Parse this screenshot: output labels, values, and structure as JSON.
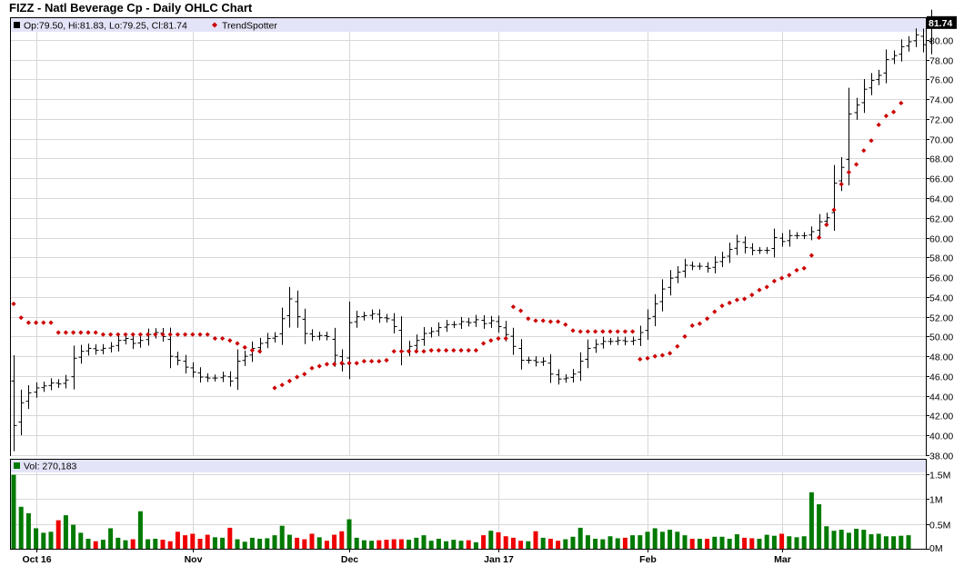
{
  "title": "FIZZ - Natl Beverage Cp - Daily OHLC Chart",
  "price_legend": {
    "ohlc_text": "Op:79.50, Hi:81.83, Lo:79.25, Cl:81.74",
    "trendspotter_label": "TrendSpotter"
  },
  "volume_legend": {
    "text": "Vol: 270,183"
  },
  "last_price_label": "81.74",
  "colors": {
    "bar": "#000000",
    "trendspotter": "#cc0000",
    "vol_up": "#007a00",
    "vol_down": "#ee0000",
    "legend_bg": "#e4e4f8",
    "grid": "#d8d8d8"
  },
  "chart_data": [
    {
      "type": "ohlc",
      "ylim": [
        38,
        82
      ],
      "yticks": [
        "38.00",
        "40.00",
        "42.00",
        "44.00",
        "46.00",
        "48.00",
        "50.00",
        "52.00",
        "54.00",
        "56.00",
        "58.00",
        "60.00",
        "62.00",
        "64.00",
        "66.00",
        "68.00",
        "70.00",
        "72.00",
        "74.00",
        "76.00",
        "78.00",
        "80.00"
      ],
      "xticks": [
        {
          "label": "Oct 16",
          "index": 3
        },
        {
          "label": "Nov",
          "index": 24
        },
        {
          "label": "Dec",
          "index": 45
        },
        {
          "label": "Jan 17",
          "index": 65
        },
        {
          "label": "Feb",
          "index": 85
        },
        {
          "label": "Mar",
          "index": 103
        }
      ],
      "series": [
        {
          "name": "OHLC",
          "close": [
            41.0,
            43.3,
            44.3,
            44.8,
            45.0,
            45.3,
            45.2,
            45.6,
            47.8,
            48.5,
            48.8,
            48.6,
            48.8,
            49.0,
            49.6,
            49.8,
            49.3,
            49.6,
            50.2,
            50.4,
            50.0,
            48.0,
            47.6,
            46.9,
            46.4,
            45.9,
            45.8,
            45.8,
            46.0,
            45.5,
            47.5,
            48.0,
            48.8,
            49.3,
            49.8,
            50.0,
            51.8,
            53.8,
            52.0,
            50.3,
            50.0,
            50.1,
            50.0,
            48.1,
            47.2,
            51.4,
            52.0,
            52.1,
            52.3,
            51.9,
            51.8,
            51.0,
            48.5,
            49.0,
            49.6,
            50.3,
            50.5,
            50.9,
            51.2,
            51.2,
            51.5,
            51.4,
            51.7,
            51.3,
            51.6,
            51.0,
            50.2,
            49.0,
            47.6,
            47.6,
            47.4,
            47.5,
            46.2,
            45.7,
            45.8,
            46.2,
            47.5,
            48.8,
            49.2,
            49.5,
            49.5,
            49.6,
            49.5,
            49.6,
            50.4,
            51.8,
            53.3,
            54.8,
            55.9,
            56.5,
            57.2,
            57.1,
            57.1,
            56.9,
            57.5,
            58.0,
            58.8,
            59.6,
            59.0,
            58.7,
            58.7,
            58.7,
            60.0,
            59.6,
            60.2,
            60.2,
            60.2,
            60.6,
            61.6,
            62.0,
            65.5,
            67.1,
            72.5,
            73.4,
            75.0,
            75.9,
            76.4,
            78.0,
            78.4,
            79.3,
            79.8,
            80.5,
            79.5,
            81.74
          ]
        },
        {
          "name": "TrendSpotter",
          "values": [
            53.3,
            51.9,
            51.4,
            51.4,
            51.4,
            51.4,
            50.4,
            50.4,
            50.4,
            50.4,
            50.4,
            50.4,
            50.2,
            50.2,
            50.2,
            50.2,
            50.2,
            50.2,
            50.2,
            50.2,
            50.2,
            50.2,
            50.2,
            50.2,
            50.2,
            50.2,
            50.2,
            49.8,
            49.8,
            49.6,
            49.3,
            48.9,
            48.6,
            48.5,
            null,
            44.8,
            45.1,
            45.5,
            45.9,
            46.2,
            46.8,
            47.0,
            47.2,
            47.2,
            47.3,
            47.3,
            47.3,
            47.5,
            47.5,
            47.5,
            47.6,
            48.5,
            48.5,
            48.5,
            48.5,
            48.5,
            48.6,
            48.6,
            48.6,
            48.6,
            48.6,
            48.6,
            48.6,
            49.3,
            49.6,
            49.8,
            49.8,
            53.0,
            52.6,
            51.8,
            51.6,
            51.6,
            51.5,
            51.5,
            51.2,
            50.6,
            50.5,
            50.5,
            50.5,
            50.5,
            50.5,
            50.5,
            50.5,
            50.5,
            47.7,
            47.8,
            48.0,
            48.1,
            48.3,
            49.0,
            50.0,
            51.1,
            51.3,
            51.8,
            52.5,
            53.1,
            53.4,
            53.7,
            53.8,
            54.2,
            54.7,
            55.0,
            55.6,
            55.9,
            56.2,
            56.7,
            56.9,
            58.2,
            60.0,
            61.3,
            62.8,
            65.4,
            66.6,
            67.4,
            68.8,
            69.8,
            71.4,
            72.3,
            72.7,
            73.6
          ]
        },
        {
          "name": "Vol",
          "values": [
            1.48,
            0.84,
            0.71,
            0.41,
            0.32,
            0.34,
            0.57,
            0.67,
            0.48,
            0.32,
            0.2,
            0.15,
            0.18,
            0.41,
            0.22,
            0.17,
            0.19,
            0.75,
            0.19,
            0.2,
            0.18,
            0.15,
            0.34,
            0.27,
            0.3,
            0.2,
            0.28,
            0.23,
            0.22,
            0.42,
            0.19,
            0.14,
            0.22,
            0.2,
            0.21,
            0.27,
            0.46,
            0.28,
            0.22,
            0.19,
            0.3,
            0.23,
            0.16,
            0.28,
            0.35,
            0.59,
            0.22,
            0.17,
            0.16,
            0.17,
            0.18,
            0.19,
            0.19,
            0.18,
            0.22,
            0.27,
            0.16,
            0.2,
            0.15,
            0.18,
            0.16,
            0.17,
            0.13,
            0.27,
            0.36,
            0.33,
            0.25,
            0.22,
            0.16,
            0.15,
            0.35,
            0.22,
            0.2,
            0.16,
            0.19,
            0.24,
            0.42,
            0.27,
            0.2,
            0.19,
            0.25,
            0.21,
            0.22,
            0.27,
            0.27,
            0.34,
            0.41,
            0.34,
            0.38,
            0.34,
            0.27,
            0.2,
            0.2,
            0.2,
            0.24,
            0.24,
            0.2,
            0.29,
            0.22,
            0.21,
            0.2,
            0.28,
            0.26,
            0.3,
            0.25,
            0.23,
            0.25,
            1.13,
            0.89,
            0.45,
            0.36,
            0.38,
            0.32,
            0.4,
            0.38,
            0.29,
            0.3,
            0.25,
            0.25,
            0.26,
            0.27
          ]
        }
      ]
    },
    {
      "type": "bar",
      "ylim": [
        0,
        1.6
      ],
      "yticks": [
        "0M",
        "0.5M",
        "1M",
        "1.5M"
      ],
      "series": [
        {
          "name": "Vol"
        }
      ]
    }
  ]
}
